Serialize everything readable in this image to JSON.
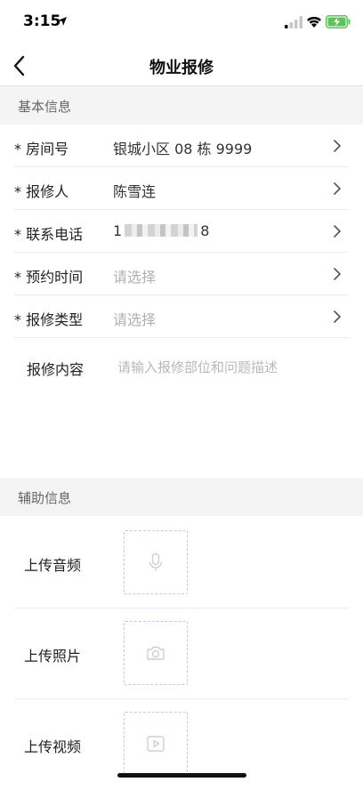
{
  "status_bar": {
    "time": "3:15"
  },
  "nav": {
    "title": "物业报修"
  },
  "basic_section": {
    "title": "基本信息",
    "rows": [
      {
        "label": "* 房间号",
        "value": "银城小区 08 栋 9999",
        "placeholder": false
      },
      {
        "label": "* 报修人",
        "value": "陈雪连",
        "placeholder": false
      },
      {
        "label": "* 联系电话",
        "value_prefix": "1",
        "value_suffix": "8",
        "blurred": true
      },
      {
        "label": "* 预约时间",
        "value": "请选择",
        "placeholder": true
      },
      {
        "label": "* 报修类型",
        "value": "请选择",
        "placeholder": true
      }
    ],
    "content_label": "报修内容",
    "content_placeholder": "请输入报修部位和问题描述"
  },
  "aux_section": {
    "title": "辅助信息",
    "uploads": [
      {
        "label": "上传音频",
        "icon": "microphone-icon"
      },
      {
        "label": "上传照片",
        "icon": "camera-icon"
      },
      {
        "label": "上传视频",
        "icon": "video-icon"
      }
    ]
  },
  "colors": {
    "accent_dashed": "#c9c6ee",
    "section_bg": "#f4f4f4",
    "placeholder": "#b0b0b0"
  }
}
